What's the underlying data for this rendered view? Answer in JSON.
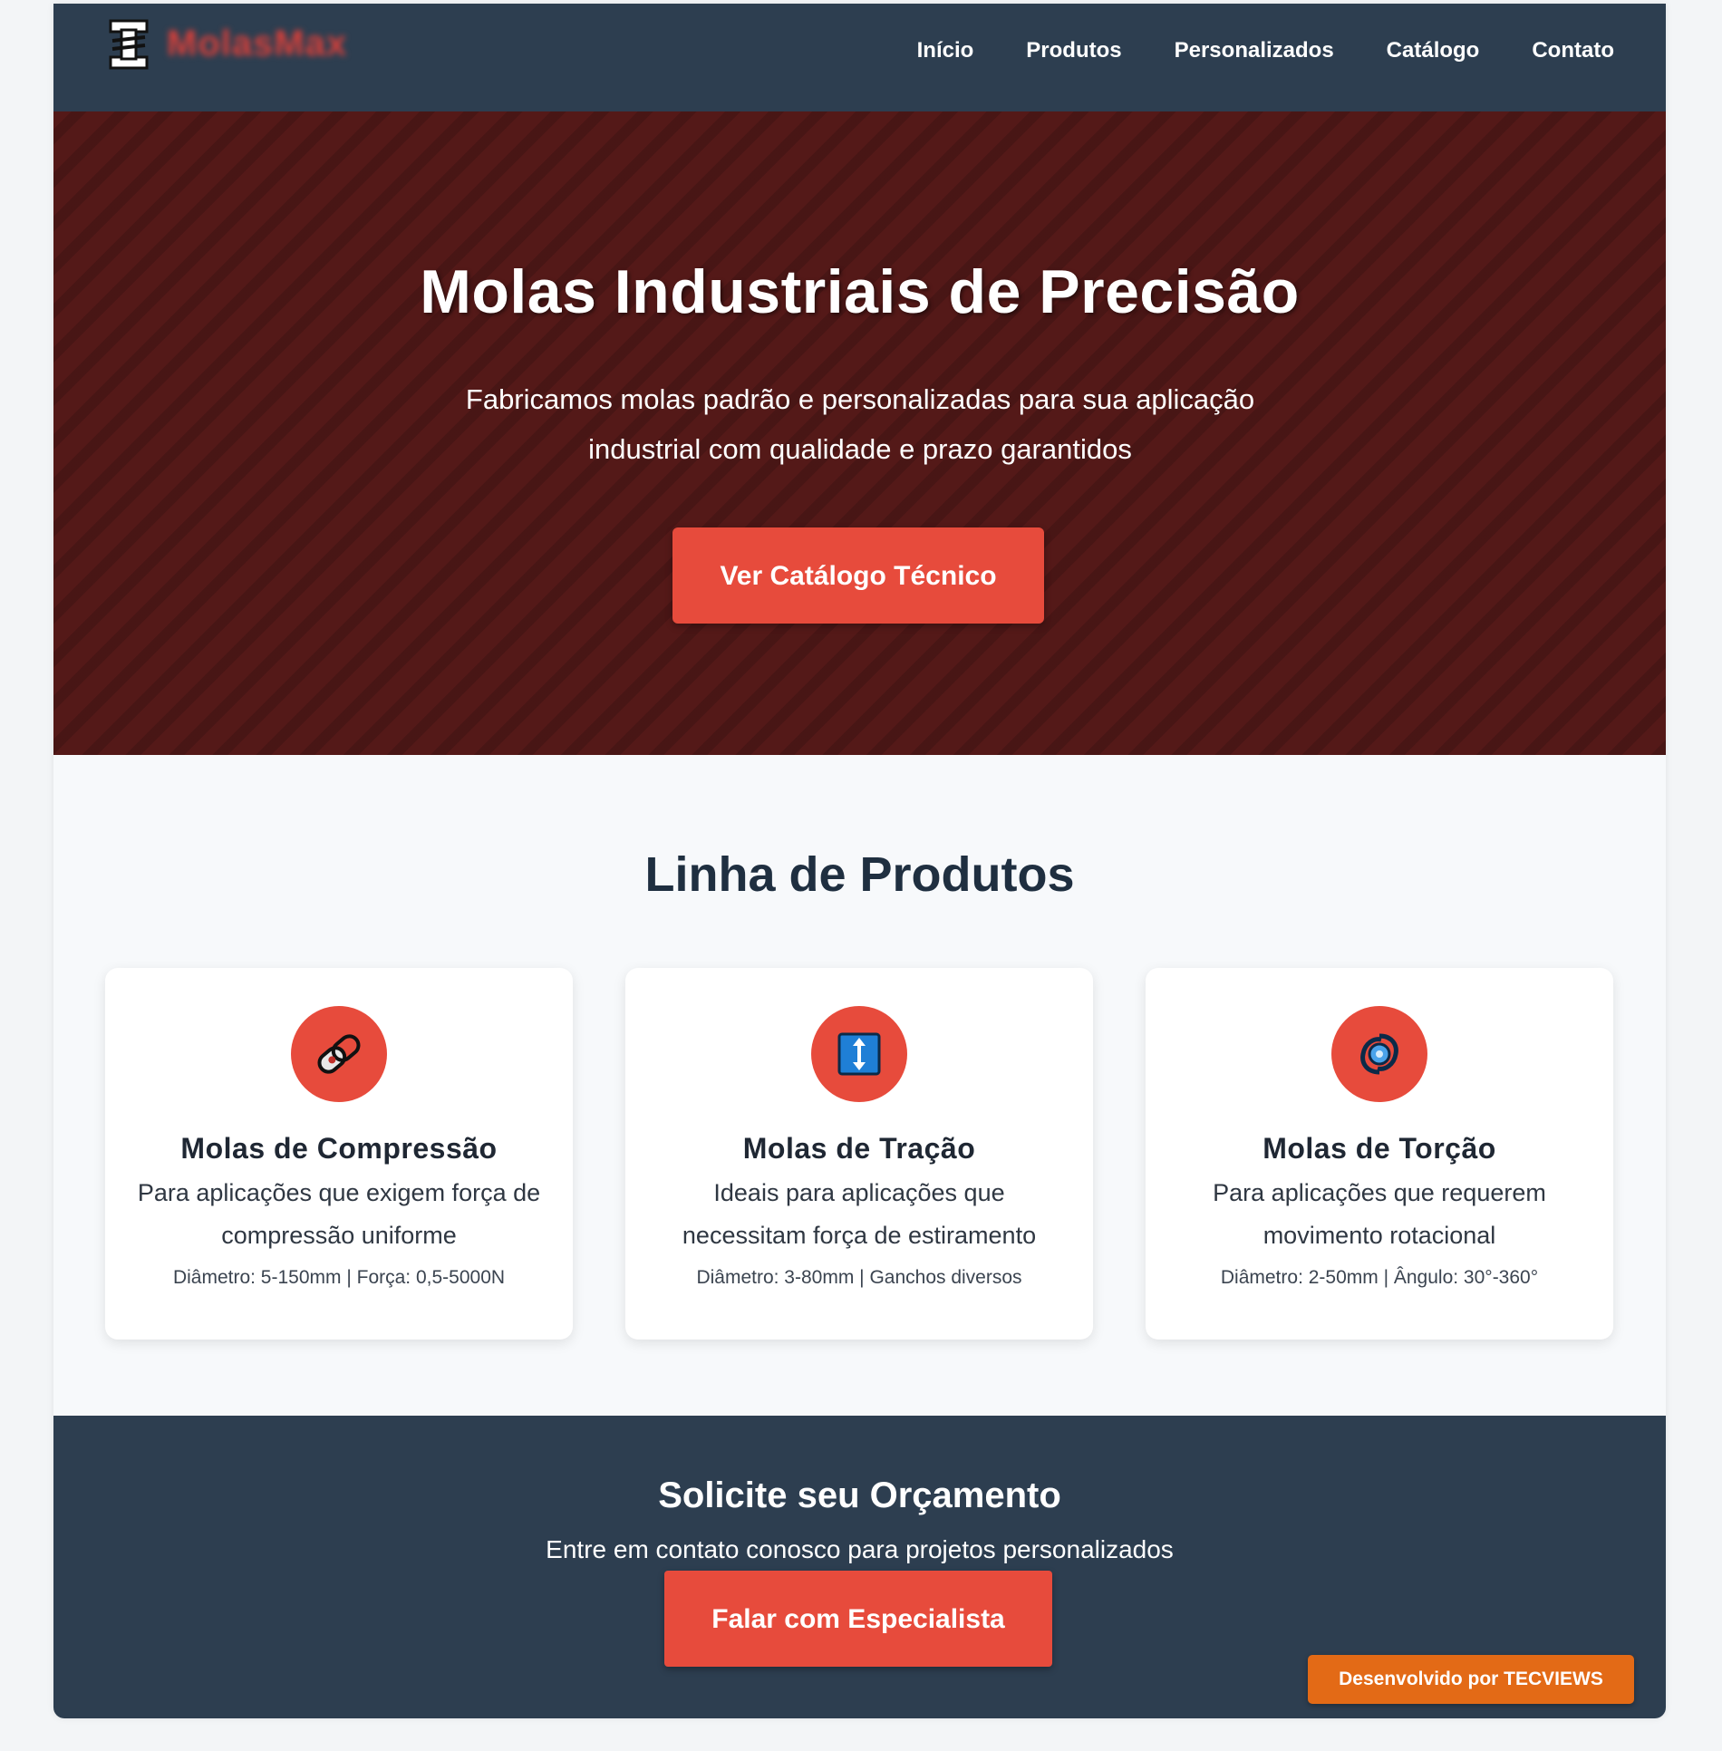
{
  "brand": {
    "name": "MolasMax"
  },
  "nav": {
    "items": [
      {
        "label": "Início"
      },
      {
        "label": "Produtos"
      },
      {
        "label": "Personalizados"
      },
      {
        "label": "Catálogo"
      },
      {
        "label": "Contato"
      }
    ]
  },
  "hero": {
    "title": "Molas Industriais de Precisão",
    "subtitle": "Fabricamos molas padrão e personalizadas para sua aplicação industrial com qualidade e prazo garantidos",
    "button_label": "Ver Catálogo Técnico"
  },
  "products": {
    "title": "Linha de Produtos",
    "items": [
      {
        "icon": "link-icon",
        "name": "Molas de Compressão",
        "description": "Para aplicações que exigem força de compressão uniforme",
        "spec": "Diâmetro: 5-150mm | Força: 0,5-5000N"
      },
      {
        "icon": "up-down-arrow-icon",
        "name": "Molas de Tração",
        "description": "Ideais para aplicações que necessitam força de estiramento",
        "spec": "Diâmetro: 3-80mm | Ganchos diversos"
      },
      {
        "icon": "cyclone-icon",
        "name": "Molas de Torção",
        "description": "Para aplicações que requerem movimento rotacional",
        "spec": "Diâmetro: 2-50mm | Ângulo: 30°-360°"
      }
    ]
  },
  "cta": {
    "title": "Solicite seu Orçamento",
    "subtitle": "Entre em contato conosco para projetos personalizados",
    "button_label": "Falar com Especialista"
  },
  "footer": {
    "badge": "Desenvolvido por TECVIEWS"
  },
  "colors": {
    "nav_bg": "#2d3e50",
    "hero_bg": "#541918",
    "accent": "#e74b3c",
    "badge": "#e36a16"
  }
}
